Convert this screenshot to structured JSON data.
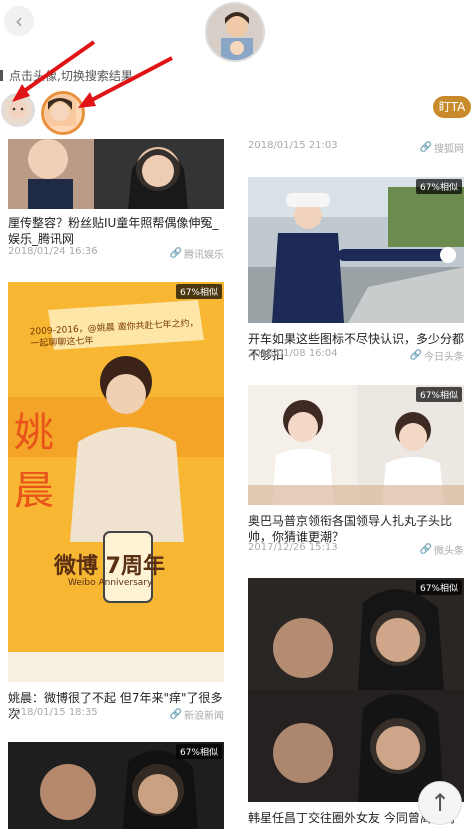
{
  "header": {
    "hint": "点击头像,切换搜索结果",
    "follow_label": "盯TA"
  },
  "icons": {
    "back": "chevron-left-icon",
    "link": "link-icon",
    "to_top": "arrow-up-icon"
  },
  "colors": {
    "follow_bg": "#c88a2a",
    "selected_border": "#e8913d",
    "badge_bg": "#333333"
  },
  "left_cards": [
    {
      "title": "厘传整容？粉丝贴IU童年照帮偶像伸冤_娱乐_腾讯网",
      "date": "2018/01/24 16:36",
      "source": "腾讯娱乐"
    },
    {
      "badge": "67%相似",
      "poster_text_1": "2009-2016，@姚晨 邀你共赴七年之约，一起聊聊这七年",
      "poster_text_2": "姚晨",
      "poster_text_3": "微博 7周年",
      "poster_text_4": "Weibo Anniversary",
      "title": "姚晨：微博很了不起 但7年来\"痒\"了很多次",
      "date": "2018/01/15 18:35",
      "source": "新浪新闻"
    },
    {
      "badge": "67%相似"
    }
  ],
  "right_cards": [
    {
      "date": "2018/01/15 21:03",
      "source": "搜狐网"
    },
    {
      "badge": "67%相似",
      "title": "开车如果这些图标不尽快认识，多少分都不够扣",
      "date": "2018/01/08 16:04",
      "source": "今日头条"
    },
    {
      "badge": "67%相似",
      "title": "奥巴马普京领衔各国领导人扎丸子头比帅，你猜谁更潮？",
      "date": "2017/12/26 15:13",
      "source": "微头条"
    },
    {
      "badge": "67%相似",
      "title": "韩星任昌丁交往圈外女友 今同曾离婚有"
    }
  ]
}
